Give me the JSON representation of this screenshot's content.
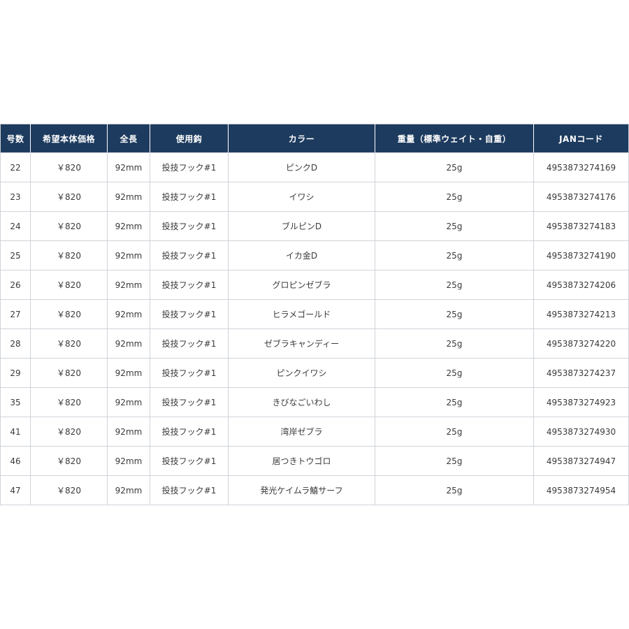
{
  "table": {
    "headers": [
      "号数",
      "希望本体価格",
      "全長",
      "使用鈎",
      "カラー",
      "重量（標準ウェイト・自重）",
      "JANコード"
    ],
    "rows": [
      [
        "22",
        "￥820",
        "92mm",
        "投技フック#1",
        "ピンクD",
        "25g",
        "4953873274169"
      ],
      [
        "23",
        "￥820",
        "92mm",
        "投技フック#1",
        "イワシ",
        "25g",
        "4953873274176"
      ],
      [
        "24",
        "￥820",
        "92mm",
        "投技フック#1",
        "ブルピンD",
        "25g",
        "4953873274183"
      ],
      [
        "25",
        "￥820",
        "92mm",
        "投技フック#1",
        "イカ金D",
        "25g",
        "4953873274190"
      ],
      [
        "26",
        "￥820",
        "92mm",
        "投技フック#1",
        "グロピンゼブラ",
        "25g",
        "4953873274206"
      ],
      [
        "27",
        "￥820",
        "92mm",
        "投技フック#1",
        "ヒラメゴールド",
        "25g",
        "4953873274213"
      ],
      [
        "28",
        "￥820",
        "92mm",
        "投技フック#1",
        "ゼブラキャンディー",
        "25g",
        "4953873274220"
      ],
      [
        "29",
        "￥820",
        "92mm",
        "投技フック#1",
        "ピンクイワシ",
        "25g",
        "4953873274237"
      ],
      [
        "35",
        "￥820",
        "92mm",
        "投技フック#1",
        "きびなごいわし",
        "25g",
        "4953873274923"
      ],
      [
        "41",
        "￥820",
        "92mm",
        "投技フック#1",
        "湾岸ゼブラ",
        "25g",
        "4953873274930"
      ],
      [
        "46",
        "￥820",
        "92mm",
        "投技フック#1",
        "居つきトウゴロ",
        "25g",
        "4953873274947"
      ],
      [
        "47",
        "￥820",
        "92mm",
        "投技フック#1",
        "発光ケイムラ鱚サーフ",
        "25g",
        "4953873274954"
      ]
    ]
  }
}
